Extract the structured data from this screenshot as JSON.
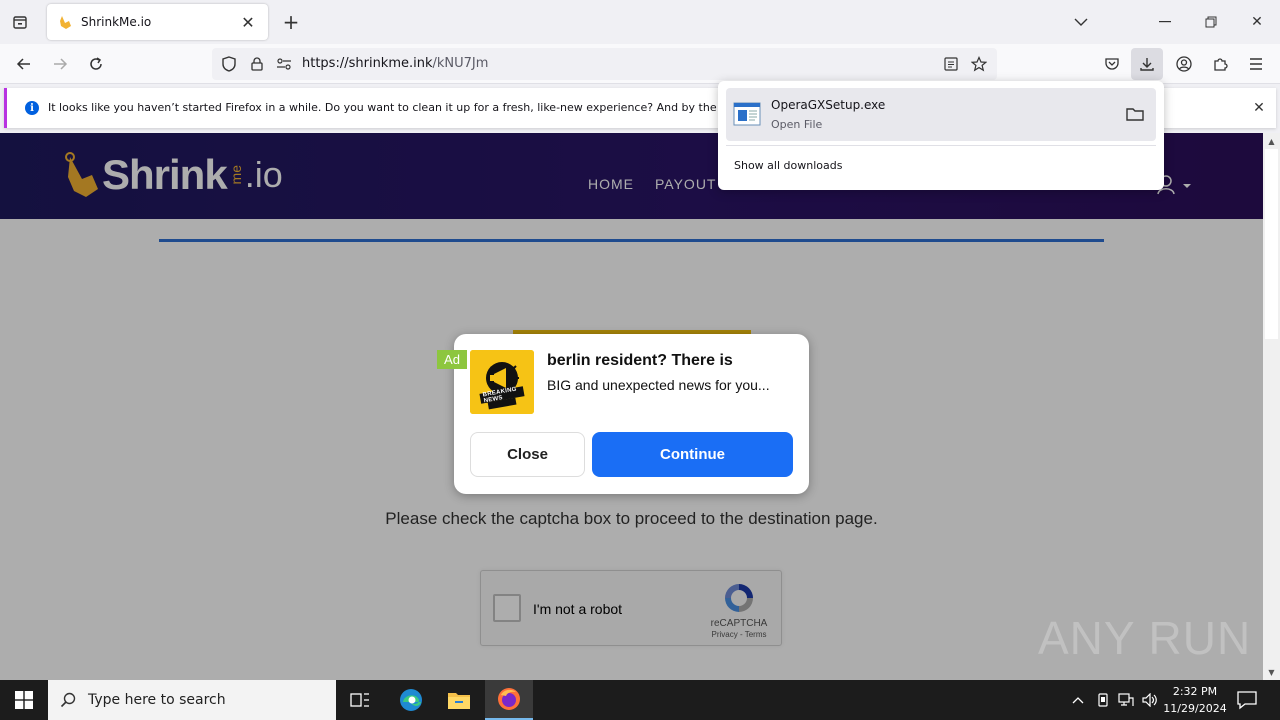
{
  "browser": {
    "tab_title": "ShrinkMe.io",
    "url_host": "https://shrinkme.ink",
    "url_path": "/kNU7Jm"
  },
  "notification": {
    "text": "It looks like you haven’t started Firefox in a while. Do you want to clean it up for a fresh, like-new experience? And by the way, w"
  },
  "downloads": {
    "file_name": "OperaGXSetup.exe",
    "status": "Open File",
    "show_all": "Show all downloads"
  },
  "site": {
    "logo_main": "Shrink",
    "logo_me": "me",
    "logo_io": ".io",
    "nav": [
      "HOME",
      "PAYOUT"
    ],
    "instruction": "Please check the captcha box to proceed to the destination page."
  },
  "recaptcha": {
    "label": "I'm not a robot",
    "brand": "reCAPTCHA",
    "links": "Privacy - Terms"
  },
  "ad": {
    "tag": "Ad",
    "image_text": "BREAKING NEWS",
    "title": "berlin resident? There is",
    "body": "BIG and unexpected news for you...",
    "close_label": "Close",
    "continue_label": "Continue"
  },
  "watermark": "ANY RUN",
  "taskbar": {
    "search_placeholder": "Type here to search",
    "time": "2:32 PM",
    "date": "11/29/2024"
  },
  "colors": {
    "header_bg": "#2a1466",
    "accent_blue": "#1a6ef5",
    "ad_tag": "#8dc63f",
    "logo_gold": "#f2b233"
  }
}
